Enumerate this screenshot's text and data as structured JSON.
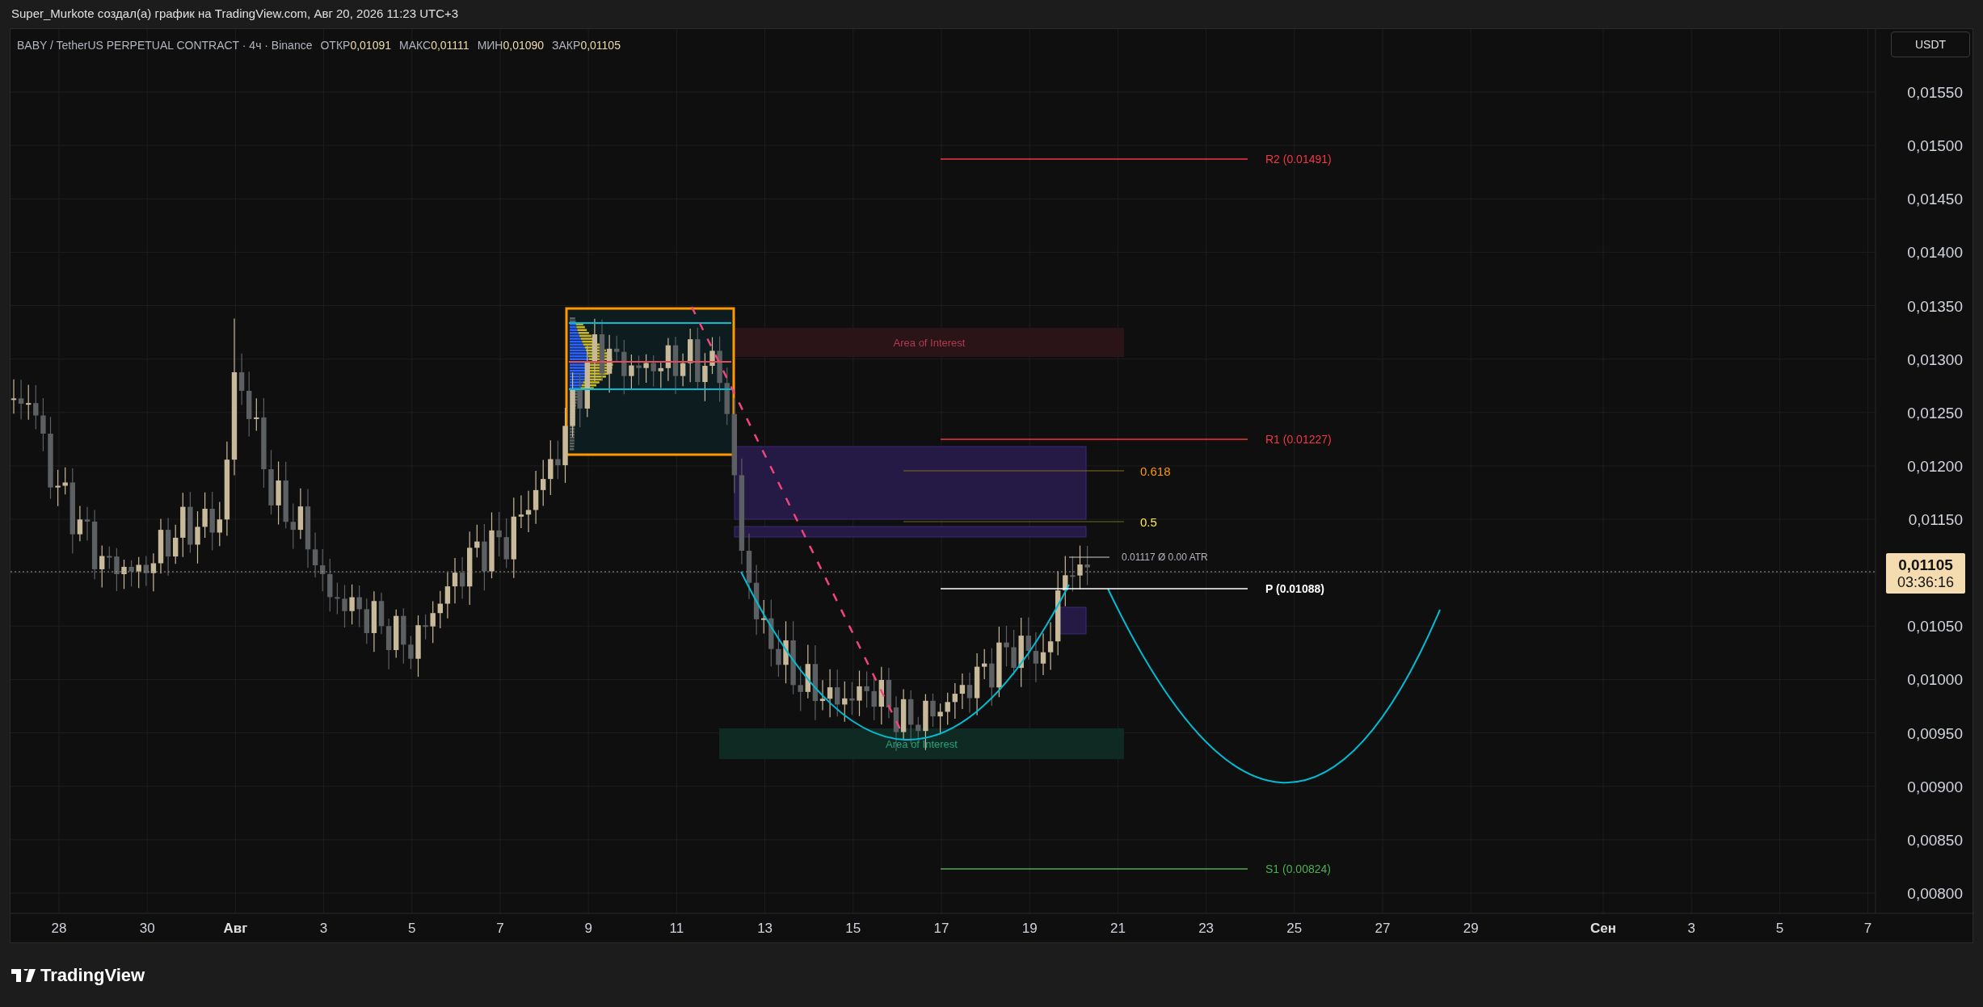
{
  "title_bar": {
    "text": "Super_Murkote создал(а) график на TradingView.com, Авг 20, 2026 11:23 UTC+3"
  },
  "legend": {
    "symbol": "BABY / TetherUS PERPETUAL CONTRACT · 4ч · Binance",
    "values": [
      {
        "label": "ОТКР",
        "value": "0,01091"
      },
      {
        "label": "МАКС",
        "value": "0,01111"
      },
      {
        "label": "МИН",
        "value": "0,01090"
      },
      {
        "label": "ЗАКР",
        "value": "0,01105"
      }
    ]
  },
  "price_axis": {
    "currency_button": "USDT",
    "ticks": [
      "0,01550",
      "0,01500",
      "0,01450",
      "0,01400",
      "0,01350",
      "0,01300",
      "0,01250",
      "0,01200",
      "0,01150",
      "0,01050",
      "0,01000",
      "0,00950",
      "0,00900",
      "0,00850",
      "0,00800"
    ],
    "last_price": "0,01105",
    "countdown": "03:36:16"
  },
  "time_axis": {
    "ticks": [
      {
        "label": "28",
        "kind": "day"
      },
      {
        "label": "30",
        "kind": "day"
      },
      {
        "label": "Авг",
        "kind": "month"
      },
      {
        "label": "3",
        "kind": "day"
      },
      {
        "label": "5",
        "kind": "day"
      },
      {
        "label": "7",
        "kind": "day"
      },
      {
        "label": "9",
        "kind": "day"
      },
      {
        "label": "11",
        "kind": "day"
      },
      {
        "label": "13",
        "kind": "day"
      },
      {
        "label": "15",
        "kind": "day"
      },
      {
        "label": "17",
        "kind": "day"
      },
      {
        "label": "19",
        "kind": "day"
      },
      {
        "label": "21",
        "kind": "day"
      },
      {
        "label": "23",
        "kind": "day"
      },
      {
        "label": "25",
        "kind": "day"
      },
      {
        "label": "27",
        "kind": "day"
      },
      {
        "label": "29",
        "kind": "day"
      },
      {
        "label": "Сен",
        "kind": "month"
      },
      {
        "label": "3",
        "kind": "day"
      },
      {
        "label": "5",
        "kind": "day"
      },
      {
        "label": "7",
        "kind": "day"
      }
    ]
  },
  "annotations": {
    "zones": [
      {
        "label": "Area of Interest",
        "kind": "supply"
      },
      {
        "label": "Area of Interest",
        "kind": "demand"
      }
    ],
    "pivots": [
      {
        "label": "R2 (0.01491)",
        "kind": "resistance"
      },
      {
        "label": "R1 (0.01227)",
        "kind": "resistance"
      },
      {
        "label": "P (0.01088)",
        "kind": "pivot"
      },
      {
        "label": "S1 (0.00824)",
        "kind": "support"
      }
    ],
    "fib_levels": [
      {
        "label": "0.618"
      },
      {
        "label": "0.5"
      }
    ],
    "atr_label": "0.01117 Ø 0.00 ATR"
  },
  "footer": {
    "logo_text": "TradingView"
  }
}
